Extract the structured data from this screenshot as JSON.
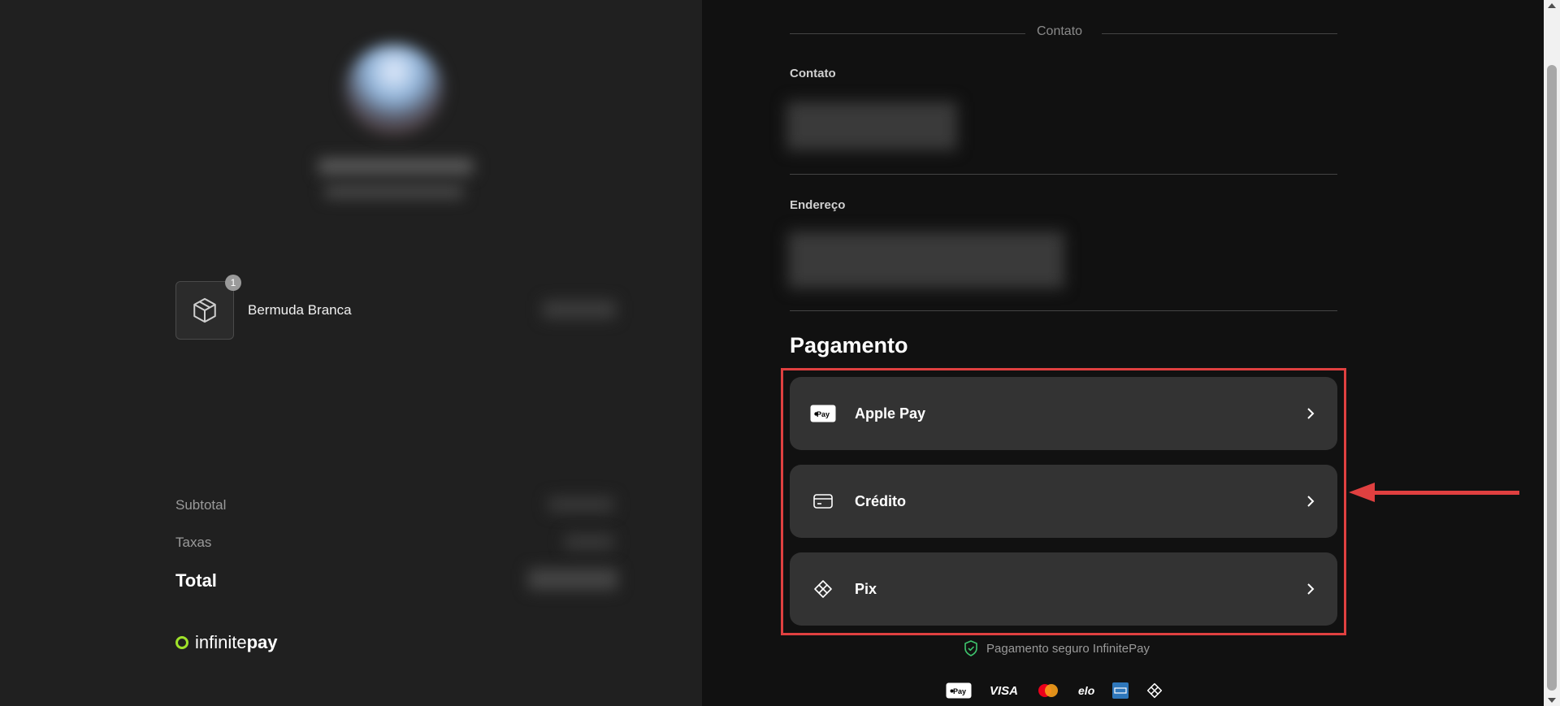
{
  "order": {
    "product_name": "Bermuda Branca",
    "quantity": "1",
    "subtotal_label": "Subtotal",
    "taxes_label": "Taxas",
    "total_label": "Total",
    "brand_prefix": "infinite",
    "brand_suffix": "pay"
  },
  "checkout": {
    "section_header": "Contato",
    "contact_label": "Contato",
    "address_label": "Endereço",
    "payment_title": "Pagamento",
    "options": [
      {
        "label": "Apple Pay",
        "icon": "apple-pay-icon"
      },
      {
        "label": "Crédito",
        "icon": "credit-card-icon"
      },
      {
        "label": "Pix",
        "icon": "pix-icon"
      }
    ],
    "secure_text": "Pagamento seguro InfinitePay",
    "logos": [
      "Apple Pay",
      "VISA",
      "Mastercard",
      "elo",
      "American Express",
      "Pix"
    ]
  },
  "colors": {
    "accent_ring": "#9fe22a",
    "highlight": "#e04040",
    "secure_shield": "#3ec46d"
  }
}
